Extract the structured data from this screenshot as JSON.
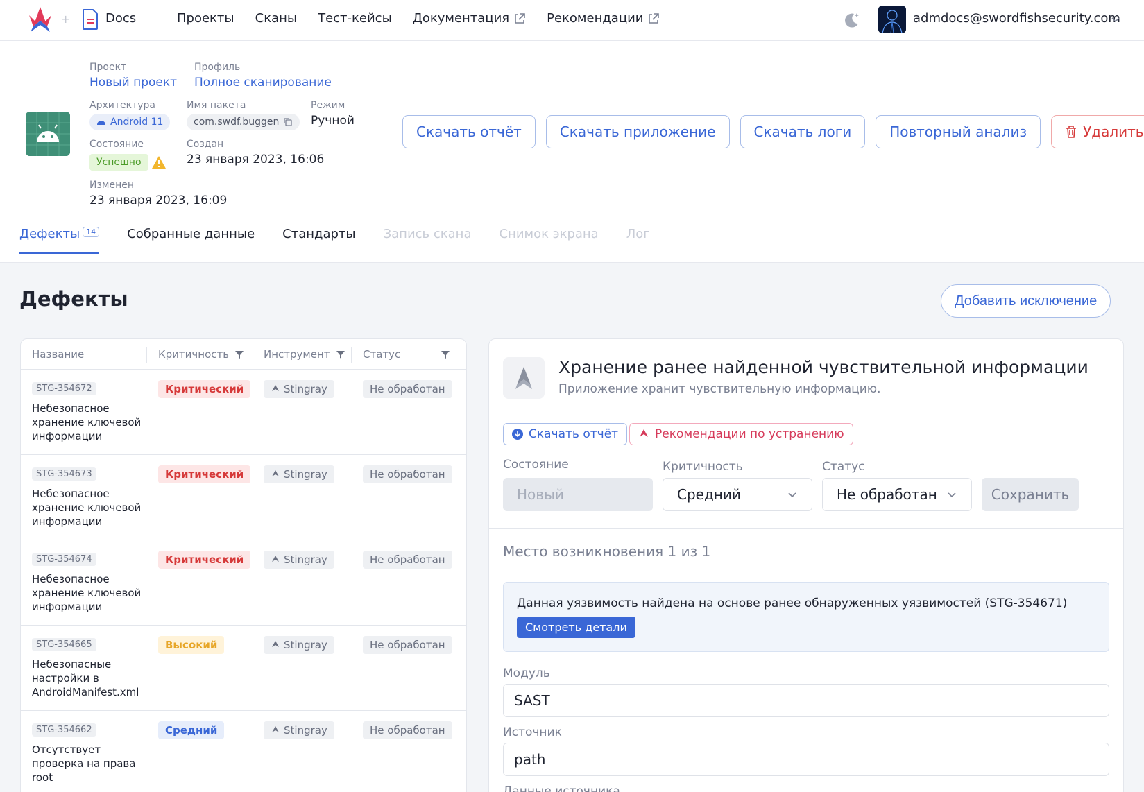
{
  "nav": {
    "docs_label": "Docs",
    "menu": [
      {
        "label": "Проекты",
        "external": false
      },
      {
        "label": "Сканы",
        "external": false
      },
      {
        "label": "Тест-кейсы",
        "external": false
      },
      {
        "label": "Документация",
        "external": true
      },
      {
        "label": "Рекомендации",
        "external": true
      }
    ],
    "user_email": "admdocs@swordfishsecurity.com"
  },
  "scan": {
    "project_label": "Проект",
    "project_value": "Новый проект",
    "profile_label": "Профиль",
    "profile_value": "Полное сканирование",
    "arch_label": "Архитектура",
    "arch_value": "Android 11",
    "package_label": "Имя пакета",
    "package_value": "com.swdf.buggen",
    "mode_label": "Режим",
    "mode_value": "Ручной",
    "state_label": "Состояние",
    "state_value": "Успешно",
    "created_label": "Создан",
    "created_value": "23 января 2023, 16:06",
    "modified_label": "Изменен",
    "modified_value": "23 января 2023, 16:09"
  },
  "actions": {
    "download_report": "Скачать отчёт",
    "download_app": "Скачать приложение",
    "download_logs": "Скачать логи",
    "reanalyze": "Повторный анализ",
    "delete": "Удалить"
  },
  "tabs": [
    {
      "label": "Дефекты",
      "badge": "14",
      "state": "active"
    },
    {
      "label": "Собранные данные",
      "state": "normal"
    },
    {
      "label": "Стандарты",
      "state": "normal"
    },
    {
      "label": "Запись скана",
      "state": "disabled"
    },
    {
      "label": "Снимок экрана",
      "state": "disabled"
    },
    {
      "label": "Лог",
      "state": "disabled"
    }
  ],
  "defects": {
    "title": "Дефекты",
    "add_exception": "Добавить исключение",
    "columns": {
      "name": "Название",
      "severity": "Критичность",
      "tool": "Инструмент",
      "status": "Статус"
    },
    "rows": [
      {
        "id": "STG-354672",
        "name": "Небезопасное хранение ключевой информации",
        "severity": "Критический",
        "sev_class": "crit",
        "tool": "Stingray",
        "status": "Не обработан"
      },
      {
        "id": "STG-354673",
        "name": "Небезопасное хранение ключевой информации",
        "severity": "Критический",
        "sev_class": "crit",
        "tool": "Stingray",
        "status": "Не обработан"
      },
      {
        "id": "STG-354674",
        "name": "Небезопасное хранение ключевой информации",
        "severity": "Критический",
        "sev_class": "crit",
        "tool": "Stingray",
        "status": "Не обработан"
      },
      {
        "id": "STG-354665",
        "name": "Небезопасные настройки в AndroidManifest.xml",
        "severity": "Высокий",
        "sev_class": "high",
        "tool": "Stingray",
        "status": "Не обработан"
      },
      {
        "id": "STG-354662",
        "name": "Отсутствует проверка на права root",
        "severity": "Средний",
        "sev_class": "med",
        "tool": "Stingray",
        "status": "Не обработан"
      }
    ]
  },
  "detail": {
    "title": "Хранение ранее найденной чувствительной информации",
    "subtitle": "Приложение хранит чувствительную информацию.",
    "download_report": "Скачать отчёт",
    "recommendations": "Рекомендации по устранению",
    "state_label": "Состояние",
    "state_value": "Новый",
    "severity_label": "Критичность",
    "severity_value": "Средний",
    "status_label": "Статус",
    "status_value": "Не обработан",
    "save": "Сохранить",
    "occurrence": "Место возникновения 1 из 1",
    "info_text": "Данная уязвимость найдена на основе ранее обнаруженных уязвимостей (STG-354671)",
    "info_button": "Смотреть детали",
    "module_label": "Модуль",
    "module_value": "SAST",
    "source_label": "Источник",
    "source_value": "path",
    "source_data_label": "Данные источника"
  },
  "colors": {
    "accent": "#3a67d6",
    "critical": "#d63a3a",
    "high": "#e7a628",
    "success": "#4b9b28"
  },
  "icons": [
    "app-logo-icon",
    "docs-icon",
    "external-link-icon",
    "moon-icon",
    "chevron-down-icon",
    "android-icon",
    "copy-icon",
    "warning-icon",
    "trash-icon",
    "filter-icon",
    "stingray-icon",
    "download-icon"
  ]
}
